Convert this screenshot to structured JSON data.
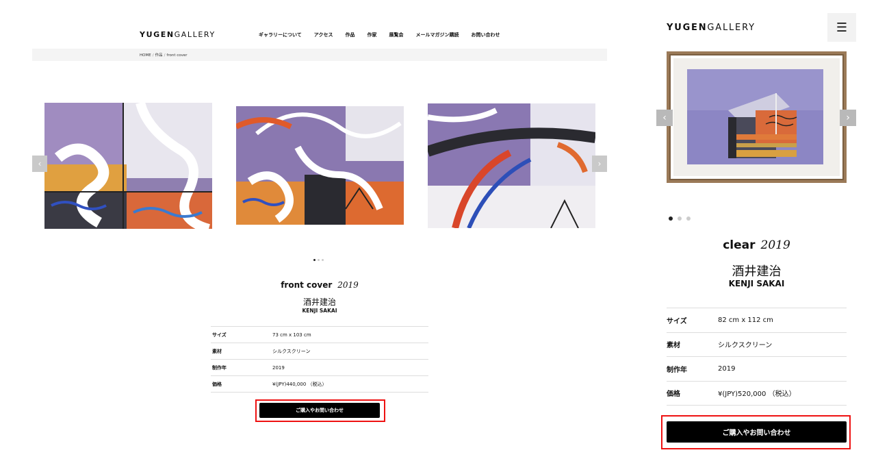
{
  "desktop": {
    "logo": {
      "bold": "YUGEN",
      "light": "GALLERY"
    },
    "nav": [
      "ギャラリーについて",
      "アクセス",
      "作品",
      "作家",
      "展覧会",
      "メールマガジン購読",
      "お問い合わせ"
    ],
    "breadcrumb": [
      "HOME",
      "作品",
      "front cover"
    ],
    "carousel": {
      "prev": "‹",
      "next": "›",
      "slides": 3,
      "active": 1
    },
    "artwork": {
      "title": "front cover",
      "year": "2019",
      "artist_jp": "酒井建治",
      "artist_en": "KENJI SAKAI"
    },
    "specs": [
      {
        "label": "サイズ",
        "value": "73 cm x 103 cm"
      },
      {
        "label": "素材",
        "value": "シルクスクリーン"
      },
      {
        "label": "制作年",
        "value": "2019"
      },
      {
        "label": "価格",
        "value": "¥(JPY)440,000 （税込）"
      }
    ],
    "cta": "ご購入やお問い合わせ"
  },
  "mobile": {
    "logo": {
      "bold": "YUGEN",
      "light": "GALLERY"
    },
    "menu_icon": "☰",
    "carousel": {
      "prev": "‹",
      "next": "›",
      "slides": 3,
      "active": 1
    },
    "artwork": {
      "title": "clear",
      "year": "2019",
      "artist_jp": "酒井建治",
      "artist_en": "KENJI SAKAI"
    },
    "specs": [
      {
        "label": "サイズ",
        "value": "82 cm x 112 cm"
      },
      {
        "label": "素材",
        "value": "シルクスクリーン"
      },
      {
        "label": "制作年",
        "value": "2019"
      },
      {
        "label": "価格",
        "value": "¥(JPY)520,000 （税込）"
      }
    ],
    "cta": "ご購入やお問い合わせ"
  },
  "colors": {
    "highlight": "#ee1111",
    "button": "#000000",
    "breadcrumb_bg": "#f4f4f4"
  }
}
